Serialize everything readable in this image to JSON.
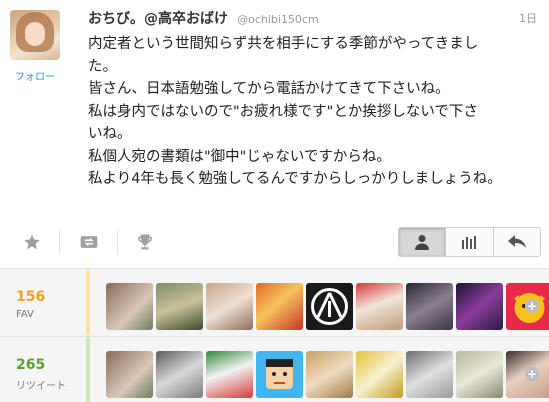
{
  "user": {
    "name": "おちび。@高卒おばけ",
    "screen_name": "@ochibi150cm",
    "follow_label": "フォロー"
  },
  "tweet": {
    "time": "1日",
    "lines": [
      "内定者という世間知らず共を相手にする季節がやってきまし",
      "た。",
      "皆さん、日本語勉強してから電話かけてきて下さいね。",
      "私は身内ではないので\"お疲れ様です\"とか挨拶しないで下さ",
      "いね。",
      "私個人宛の書類は\"御中\"じゃないですからね。",
      "私より4年も長く勉強してるんですからしっかりしましょうね。"
    ]
  },
  "actions": {
    "favorite_icon": "star-icon",
    "retweet_icon": "retweet-icon",
    "trophy_icon": "trophy-icon",
    "user_icon": "user-icon",
    "stats_icon": "bar-chart-icon",
    "reply_icon": "reply-icon"
  },
  "stats": {
    "fav": {
      "count": "156",
      "label": "FAV"
    },
    "retweet": {
      "count": "265",
      "label": "リツイート"
    }
  },
  "colors": {
    "fav_accent": "#f0a020",
    "retweet_accent": "#5aa02a",
    "link": "#2a8fd6"
  }
}
